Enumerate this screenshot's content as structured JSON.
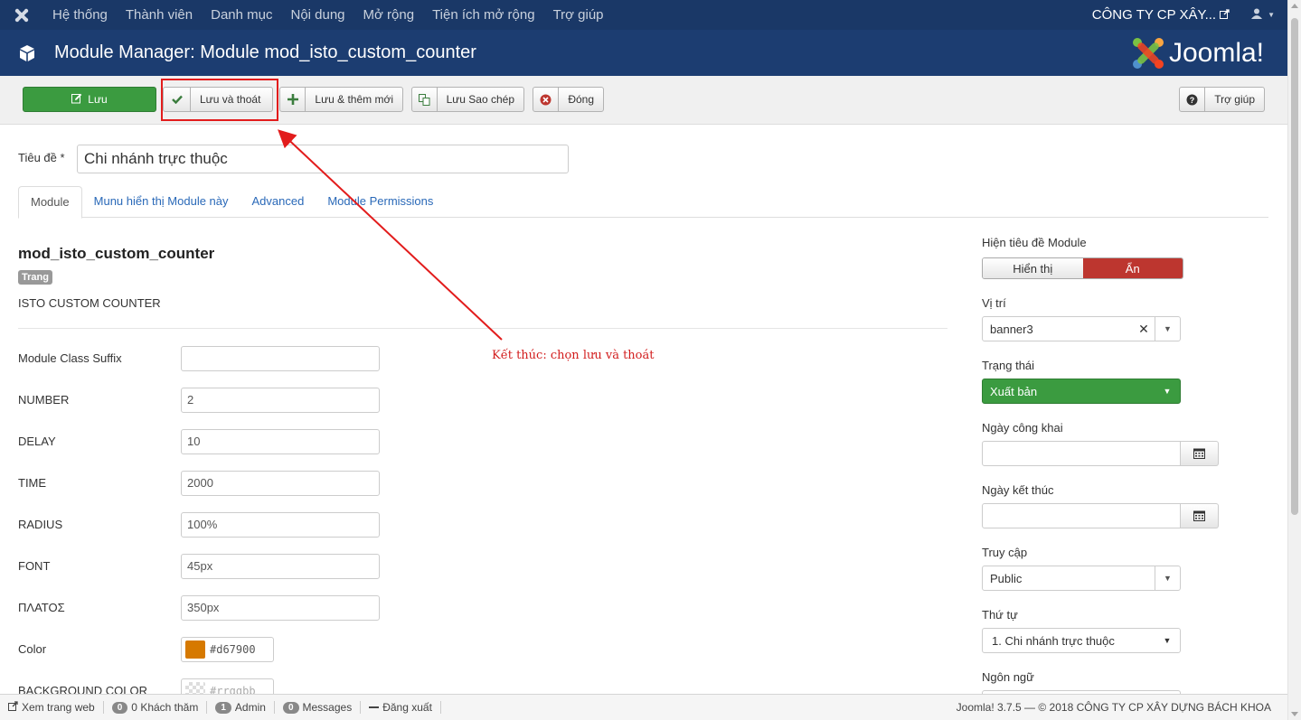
{
  "topnav": {
    "menu": [
      "Hệ thống",
      "Thành viên",
      "Danh mục",
      "Nội dung",
      "Mở rộng",
      "Tiện ích mở rộng",
      "Trợ giúp"
    ],
    "company": "CÔNG TY CP XÂY...",
    "icons": [
      "joomla-icon",
      "external-link-icon",
      "user-icon",
      "caret-down-icon"
    ]
  },
  "header": {
    "title": "Module Manager: Module mod_isto_custom_counter",
    "brand": "Joomla!"
  },
  "toolbar": {
    "save": "Lưu",
    "save_close": "Lưu và thoát",
    "save_new": "Lưu & thêm mới",
    "save_copy": "Lưu Sao chép",
    "close": "Đóng",
    "help": "Trợ giúp"
  },
  "title_field": {
    "label": "Tiêu đề *",
    "value": "Chi nhánh trực thuộc"
  },
  "tabs": [
    "Module",
    "Munu hiển thị Module này",
    "Advanced",
    "Module Permissions"
  ],
  "module": {
    "name": "mod_isto_custom_counter",
    "badge": "Trang",
    "description": "ISTO CUSTOM COUNTER"
  },
  "fields": [
    {
      "label": "Module Class Suffix",
      "value": ""
    },
    {
      "label": "NUMBER",
      "value": "2"
    },
    {
      "label": "DELAY",
      "value": "10"
    },
    {
      "label": "TIME",
      "value": "2000"
    },
    {
      "label": "RADIUS",
      "value": "100%"
    },
    {
      "label": "FONT",
      "value": "45px"
    },
    {
      "label": "ΠΛΑΤΟΣ",
      "value": "350px"
    }
  ],
  "color_fields": [
    {
      "label": "Color",
      "value": "#d67900",
      "swatch": "#d67900"
    },
    {
      "label": "BACKGROUND COLOR",
      "value": "#rrggbb",
      "swatch": "transparent"
    }
  ],
  "annotation": "Kết thúc: chọn lưu và thoát",
  "sidebar": {
    "show_title_label": "Hiện tiêu đề Module",
    "show_option": "Hiển thị",
    "hide_option": "Ẩn",
    "position_label": "Vị trí",
    "position_value": "banner3",
    "status_label": "Trạng thái",
    "status_value": "Xuất bản",
    "publish_up_label": "Ngày công khai",
    "publish_down_label": "Ngày kết thúc",
    "access_label": "Truy cập",
    "access_value": "Public",
    "order_label": "Thứ tự",
    "order_value": "1. Chi nhánh trực thuộc",
    "language_label": "Ngôn ngữ"
  },
  "statusbar": {
    "view_site": "Xem trang web",
    "visitors_count": "0",
    "visitors": "Khách thăm",
    "admin_count": "1",
    "admin": "Admin",
    "messages_count": "0",
    "messages": "Messages",
    "logout": "Đăng xuất",
    "version": "Joomla! 3.7.5",
    "copyright": "— © 2018 CÔNG TY CP XÂY DỰNG BÁCH KHOA"
  },
  "colors": {
    "nav": "#1a3867",
    "header": "#1c3d71",
    "success": "#3b9b40",
    "danger": "#bd362f",
    "annotation": "#e21c1c"
  }
}
